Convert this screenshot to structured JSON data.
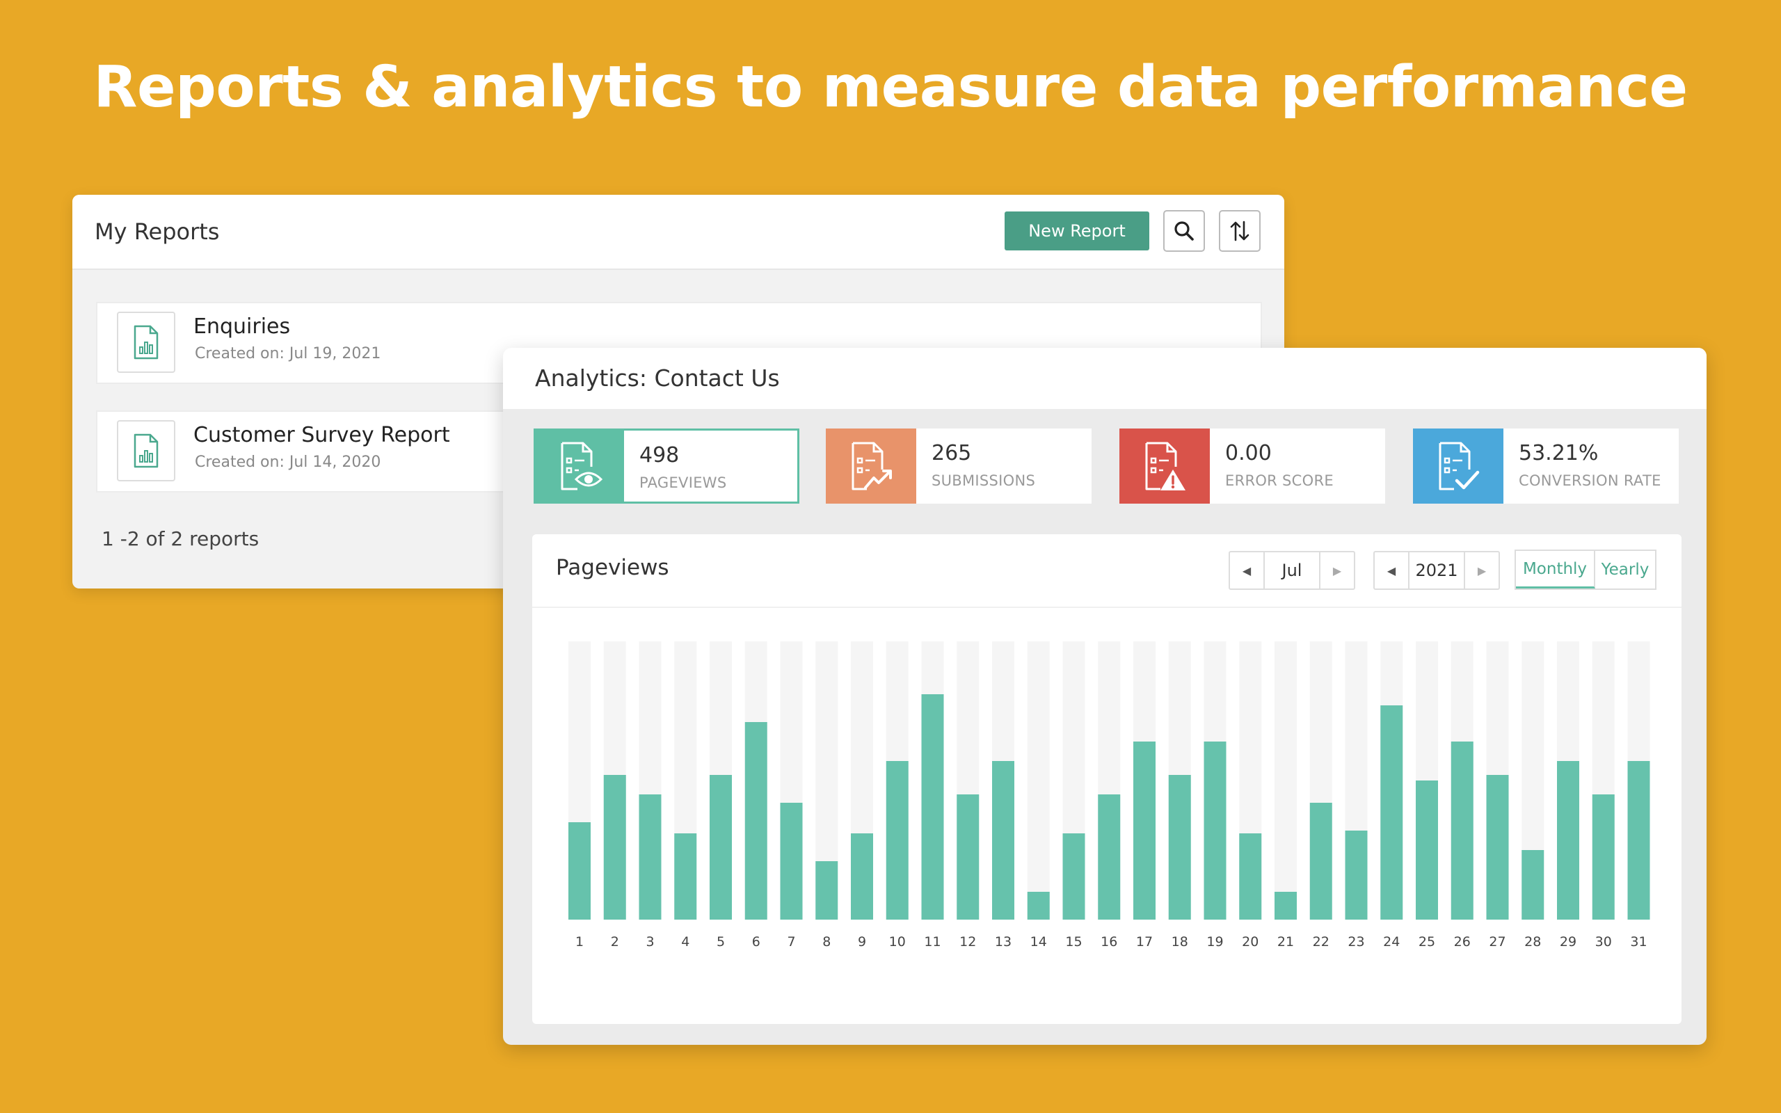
{
  "headline": "Reports & analytics to measure data performance",
  "my_reports": {
    "title": "My Reports",
    "new_report_label": "New Report",
    "reports": [
      {
        "name": "Enquiries",
        "created": "Created on: Jul 19, 2021"
      },
      {
        "name": "Customer Survey Report",
        "created": "Created on: Jul 14, 2020"
      }
    ],
    "count_text": "1 -2 of 2 reports"
  },
  "analytics": {
    "title": "Analytics: Contact Us",
    "stats": [
      {
        "value": "498",
        "label": "PAGEVIEWS",
        "color": "#5fbfa5",
        "icon": "document-eye-icon"
      },
      {
        "value": "265",
        "label": "SUBMISSIONS",
        "color": "#E8936A",
        "icon": "document-trend-icon"
      },
      {
        "value": "0.00",
        "label": "ERROR SCORE",
        "color": "#D9534A",
        "icon": "document-warning-icon"
      },
      {
        "value": "53.21%",
        "label": "CONVERSION RATE",
        "color": "#4BA8DB",
        "icon": "document-check-icon"
      }
    ],
    "chart": {
      "title": "Pageviews",
      "month": "Jul",
      "year": "2021",
      "view_monthly": "Monthly",
      "view_yearly": "Yearly"
    }
  },
  "colors": {
    "background": "#E8A826",
    "accent": "#5fbfa5",
    "button": "#4a9e86"
  },
  "chart_data": {
    "type": "bar",
    "categories": [
      "1",
      "2",
      "3",
      "4",
      "5",
      "6",
      "7",
      "8",
      "9",
      "10",
      "11",
      "12",
      "13",
      "14",
      "15",
      "16",
      "17",
      "18",
      "19",
      "20",
      "21",
      "22",
      "23",
      "24",
      "25",
      "26",
      "27",
      "28",
      "29",
      "30",
      "31"
    ],
    "values": [
      35,
      52,
      45,
      31,
      52,
      71,
      42,
      21,
      31,
      57,
      81,
      45,
      57,
      10,
      31,
      45,
      64,
      52,
      64,
      31,
      10,
      42,
      32,
      77,
      50,
      64,
      52,
      25,
      57,
      45,
      57
    ],
    "ylim": [
      0,
      100
    ],
    "grid": false,
    "bar_color": "#66c2ac",
    "track_color": "#f5f5f5"
  }
}
